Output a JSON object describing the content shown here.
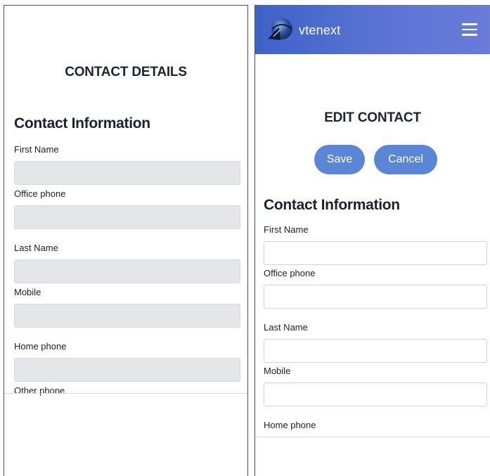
{
  "detail_view": {
    "heading": "CONTACT DETAILS",
    "section_title": "Contact Information",
    "fields": [
      {
        "label": "First Name",
        "value": ""
      },
      {
        "label": "Office phone",
        "value": ""
      },
      {
        "label": "Last Name",
        "value": ""
      },
      {
        "label": "Mobile",
        "value": ""
      },
      {
        "label": "Home phone",
        "value": ""
      },
      {
        "label": "Other phone",
        "value": ""
      }
    ]
  },
  "edit_view": {
    "app": {
      "brand": "vtenext",
      "logo_icon": "globe-logo-icon",
      "menu_icon": "hamburger-menu-icon",
      "header_color": "#4f6bd0"
    },
    "heading": "EDIT CONTACT",
    "actions": {
      "save_label": "Save",
      "cancel_label": "Cancel",
      "button_color": "#5b86d6"
    },
    "section_title": "Contact Information",
    "fields": [
      {
        "label": "First Name",
        "value": ""
      },
      {
        "label": "Office phone",
        "value": ""
      },
      {
        "label": "Last Name",
        "value": ""
      },
      {
        "label": "Mobile",
        "value": ""
      },
      {
        "label": "Home phone",
        "value": ""
      }
    ]
  }
}
